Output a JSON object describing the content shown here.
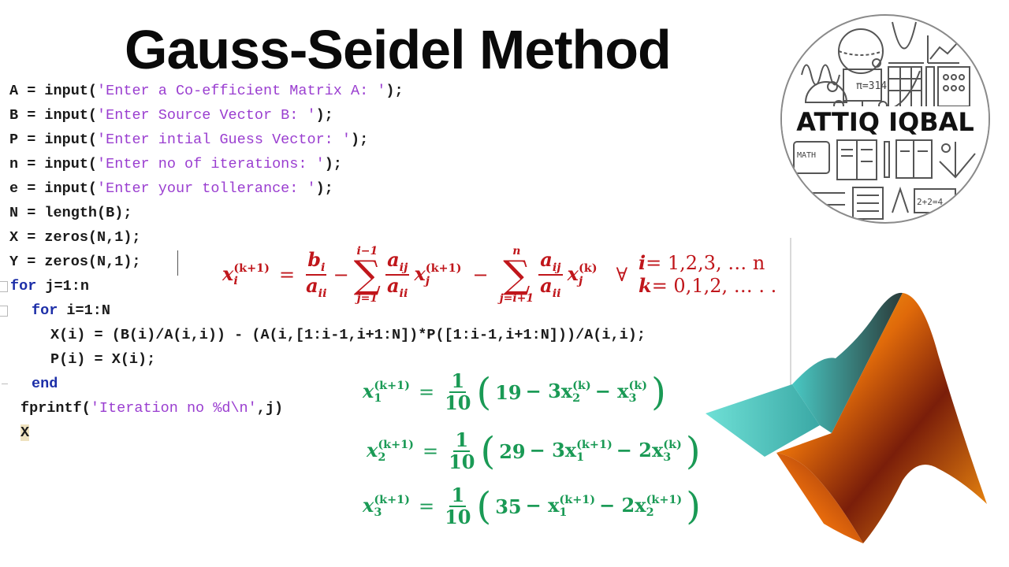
{
  "title": "Gauss-Seidel Method",
  "code": {
    "lines": [
      {
        "pre": "A = input(",
        "str": "'Enter a Co-efficient Matrix A: '",
        "post": ");"
      },
      {
        "pre": "B = input(",
        "str": "'Enter Source Vector B: '",
        "post": ");"
      },
      {
        "pre": "P = input(",
        "str": "'Enter intial Guess Vector: '",
        "post": ");"
      },
      {
        "pre": "n = input(",
        "str": "'Enter no of iterations: '",
        "post": ");"
      },
      {
        "pre": "e = input(",
        "str": "'Enter your tollerance: '",
        "post": ");"
      },
      {
        "text": "N = length(B);"
      },
      {
        "text": "X = zeros(N,1);"
      },
      {
        "text": "Y = zeros(N,1);"
      },
      {
        "kw": "for",
        "text": " j=1:n"
      },
      {
        "kw": "for",
        "text": " i=1:N"
      },
      {
        "text": "X(i) = (B(i)/A(i,i)) - (A(i,[1:i-1,i+1:N])*P([1:i-1,i+1:N]))/A(i,i);"
      },
      {
        "text": "P(i) = X(i);"
      },
      {
        "kw": "end"
      },
      {
        "pre": "fprintf(",
        "str": "'Iteration no %d\\n'",
        "post": ",j)"
      },
      {
        "text": "X"
      }
    ]
  },
  "general_formula": {
    "lhs_var": "x",
    "lhs_sub": "i",
    "lhs_sup": "(k+1)",
    "eq": "=",
    "frac1_num": "b",
    "frac1_num_sub": "i",
    "frac1_den": "a",
    "frac1_den_sub": "ii",
    "minus": "−",
    "sum1_top": "i−1",
    "sum1_bottom": "j=1",
    "sum_symbol": "∑",
    "term_num": "a",
    "term_num_sub": "ij",
    "term_den": "a",
    "term_den_sub": "ii",
    "term1_var": "x",
    "term1_sub": "j",
    "term1_sup": "(k+1)",
    "sum2_top": "n",
    "sum2_bottom": "j=i+1",
    "term2_sup": "(k)",
    "forall": "∀",
    "cond_i": "i",
    "cond_i_vals": "= 1,2,3, … n",
    "cond_k": "k",
    "cond_k_vals": "= 0,1,2, … . ."
  },
  "system_equations": [
    {
      "lhs_sub": "1",
      "lhs_sup": "(k+1)",
      "const": "19",
      "terms": [
        {
          "coef": "− 3x",
          "sub": "2",
          "sup": "(k)"
        },
        {
          "coef": "− x",
          "sub": "3",
          "sup": "(k)"
        }
      ]
    },
    {
      "lhs_sub": "2",
      "lhs_sup": "(k+1)",
      "const": "29",
      "terms": [
        {
          "coef": "− 3x",
          "sub": "1",
          "sup": "(k+1)"
        },
        {
          "coef": "− 2x",
          "sub": "3",
          "sup": "(k)"
        }
      ]
    },
    {
      "lhs_sub": "3",
      "lhs_sup": "(k+1)",
      "const": "35",
      "terms": [
        {
          "coef": "− x",
          "sub": "1",
          "sup": "(k+1)"
        },
        {
          "coef": "− 2x",
          "sub": "2",
          "sup": "(k+1)"
        }
      ]
    }
  ],
  "system_common": {
    "var": "x",
    "eq": "=",
    "num": "1",
    "den": "10",
    "lparen": "(",
    "rparen": ")"
  },
  "logo": {
    "text": "ATTIQ IQBAL",
    "badge": "π=314",
    "math_label": "MATH",
    "sum_label": "2+2=4"
  },
  "colors": {
    "formula_red": "#c0161b",
    "formula_green": "#1a9a55",
    "keyword_blue": "#1d2fa8",
    "string_purple": "#9a3ed0"
  }
}
